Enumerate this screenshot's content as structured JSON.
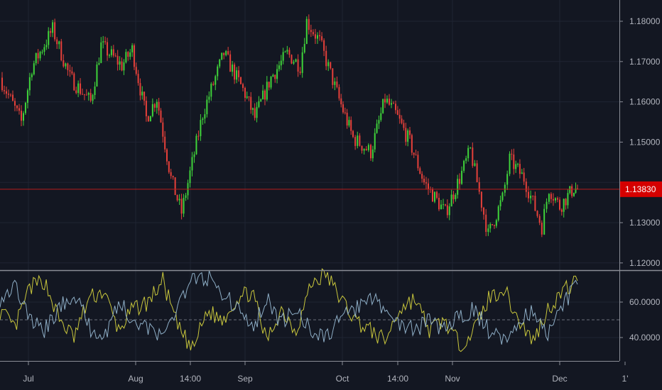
{
  "chart_data": [
    {
      "type": "candlestick",
      "title": "",
      "colors": {
        "up": "#3fd33a",
        "down": "#e5403a",
        "background": "#131722",
        "grid": "#1f2433",
        "last_price": "#d50000"
      },
      "y_ticks": [
        "1.18000",
        "1.17000",
        "1.16000",
        "1.15000",
        "1.13000",
        "1.12000"
      ],
      "y_tick_values": [
        1.18,
        1.17,
        1.16,
        1.15,
        1.13,
        1.12
      ],
      "ylim": [
        1.1185,
        1.1855
      ],
      "last_price": 1.1383,
      "last_price_label": "1.13830",
      "x_ticks": [
        "Jul",
        "Aug",
        "14:00",
        "Sep",
        "Oct",
        "14:00",
        "Nov",
        "Dec",
        "1'"
      ],
      "close_path": [
        {
          "x": "Jun 23",
          "y": 1.166
        },
        {
          "x": "Jun 29",
          "y": 1.155
        },
        {
          "x": "Jul 2",
          "y": 1.1686
        },
        {
          "x": "Jul 8",
          "y": 1.178
        },
        {
          "x": "Jul 13",
          "y": 1.166
        },
        {
          "x": "Jul 19",
          "y": 1.16
        },
        {
          "x": "Jul 22",
          "y": 1.174
        },
        {
          "x": "Jul 28",
          "y": 1.169
        },
        {
          "x": "Jul 31",
          "y": 1.173
        },
        {
          "x": "Aug 4",
          "y": 1.156
        },
        {
          "x": "Aug 7",
          "y": 1.161
        },
        {
          "x": "Aug 11",
          "y": 1.141
        },
        {
          "x": "Aug 14",
          "y": 1.1325
        },
        {
          "x": "Aug 20",
          "y": 1.157
        },
        {
          "x": "Aug 26",
          "y": 1.172
        },
        {
          "x": "Sep 1",
          "y": 1.162
        },
        {
          "x": "Sep 4",
          "y": 1.156
        },
        {
          "x": "Sep 9",
          "y": 1.166
        },
        {
          "x": "Sep 14",
          "y": 1.172
        },
        {
          "x": "Sep 18",
          "y": 1.169
        },
        {
          "x": "Sep 20",
          "y": 1.18
        },
        {
          "x": "Sep 24",
          "y": 1.175
        },
        {
          "x": "Sep 30",
          "y": 1.1606
        },
        {
          "x": "Oct 4",
          "y": 1.151
        },
        {
          "x": "Oct 9",
          "y": 1.1475
        },
        {
          "x": "Oct 13",
          "y": 1.1606
        },
        {
          "x": "Oct 16",
          "y": 1.157
        },
        {
          "x": "Oct 20",
          "y": 1.15
        },
        {
          "x": "Oct 24",
          "y": 1.14
        },
        {
          "x": "Oct 30",
          "y": 1.1325
        },
        {
          "x": "Nov 3",
          "y": 1.141
        },
        {
          "x": "Nov 6",
          "y": 1.148
        },
        {
          "x": "Nov 11",
          "y": 1.127
        },
        {
          "x": "Nov 15",
          "y": 1.136
        },
        {
          "x": "Nov 17",
          "y": 1.1457
        },
        {
          "x": "Nov 21",
          "y": 1.141
        },
        {
          "x": "Nov 26",
          "y": 1.129
        },
        {
          "x": "Nov 28",
          "y": 1.1386
        },
        {
          "x": "Dec 1",
          "y": 1.134
        },
        {
          "x": "Dec 5",
          "y": 1.1386
        },
        {
          "x": "Dec 6",
          "y": 1.1383
        }
      ]
    },
    {
      "type": "line",
      "title": "",
      "y_ticks": [
        "60.0000",
        "40.0000"
      ],
      "y_tick_values": [
        60,
        40
      ],
      "ylim": [
        22,
        78
      ],
      "midline": 50,
      "x_range": [
        "Jun 23",
        "Dec 6"
      ],
      "series": [
        {
          "color": "#c9c73c",
          "values": [
            55,
            45,
            68,
            72,
            50,
            40,
            62,
            66,
            44,
            56,
            60,
            72,
            46,
            33,
            55,
            50,
            62,
            66,
            38,
            56,
            44,
            70,
            76,
            62,
            50,
            44,
            38,
            56,
            62,
            44,
            50,
            36,
            44,
            62,
            68,
            50,
            38,
            56,
            66,
            72
          ]
        },
        {
          "color": "#8eaec6",
          "values": [
            62,
            70,
            50,
            44,
            56,
            66,
            46,
            40,
            60,
            50,
            46,
            38,
            60,
            72,
            74,
            66,
            56,
            44,
            62,
            48,
            56,
            44,
            40,
            50,
            56,
            62,
            56,
            48,
            44,
            50,
            44,
            52,
            56,
            44,
            38,
            50,
            56,
            42,
            58,
            70
          ]
        }
      ]
    }
  ]
}
